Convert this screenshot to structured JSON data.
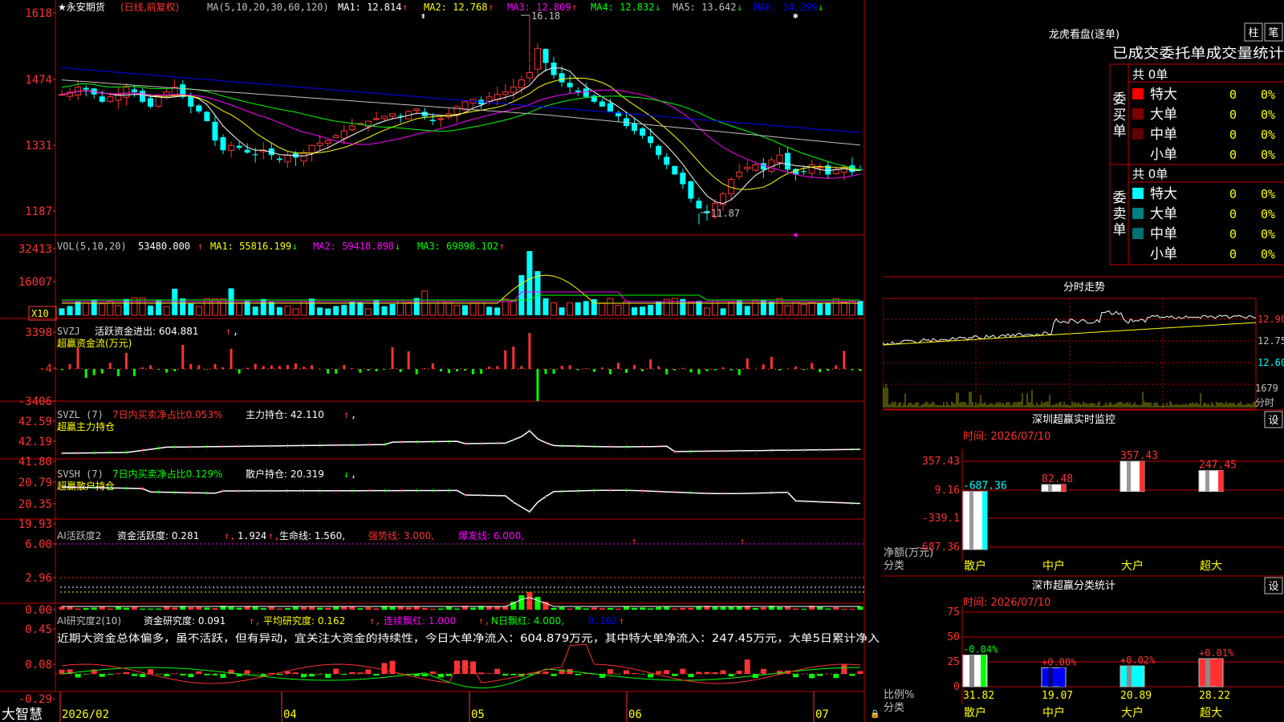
{
  "colors": {
    "up": "#ff3232",
    "down": "#00ffff",
    "frame": "#c00000",
    "green": "#00ff00",
    "yellow": "#ffff00",
    "magenta": "#ff00ff",
    "white": "#ffffff",
    "teal": "#008080",
    "darkred": "#800000",
    "gray": "#c0c0c0",
    "blue": "#0000ff"
  },
  "kline": {
    "name": "★永安期货",
    "period": "(日线,前复权)",
    "ma_def": "MA(5,10,20,30,60,120)",
    "ma_items": [
      {
        "text": "MA1: 12.814",
        "arrow": "↑",
        "color": "#ffffff"
      },
      {
        "text": "MA2: 12.768",
        "arrow": "↑",
        "color": "#ffff00"
      },
      {
        "text": "MA3: 12.809",
        "arrow": "↑",
        "color": "#ff00ff"
      },
      {
        "text": "MA4: 12.832",
        "arrow": "↓",
        "color": "#00ff00"
      },
      {
        "text": "MA5: 13.642",
        "arrow": "↓",
        "color": "#c0c0c0"
      },
      {
        "text": "MA6: 14.299",
        "arrow": "↓",
        "color": "#0000ff"
      }
    ],
    "yticks": [
      "1618",
      "1474",
      "1331",
      "1187"
    ],
    "high_label": "16.18",
    "low_label": "11.87",
    "ylim": [
      11.7,
      16.3
    ],
    "high": 16.18,
    "low": 11.87
  },
  "vol": {
    "label": "VOL(5,10,20)",
    "value": "53480.000",
    "items": [
      {
        "text": "MA1: 55816.199",
        "arrow": "↓",
        "color": "#ffff00"
      },
      {
        "text": "MA2: 59418.898",
        "arrow": "↓",
        "color": "#ff00ff"
      },
      {
        "text": "MA3: 69898.102",
        "arrow": "↑",
        "color": "#00ff00"
      }
    ],
    "yticks": [
      "32413",
      "16007"
    ],
    "unit": "X10"
  },
  "svzj": {
    "label": "SVZJ",
    "value_text": "活跃资金进出: 604.881",
    "arrow": "↑",
    "tail": ",",
    "sub": "超赢资金流(万元)",
    "yticks": [
      "3398",
      "-4",
      "-3406"
    ]
  },
  "svzl": {
    "label": "SVZL (7)",
    "ratio_text": "7日内买卖净占比0.053%",
    "value_text": "主力持仓: 42.110",
    "arrow": "↑",
    "tail": ",",
    "sub": "超赢主力持仓",
    "yticks": [
      "42.59",
      "42.19",
      "41.80"
    ]
  },
  "svsh": {
    "label": "SVSH (7)",
    "ratio_text": "7日内买卖净占比0.129%",
    "value_text": "散户持仓: 20.319",
    "arrow": "↓",
    "tail": ",",
    "sub": "超赢散户持仓",
    "yticks": [
      "20.79",
      "20.35",
      "19.93"
    ]
  },
  "ai1": {
    "label": "AI活跃度2",
    "t1": "资金活跃度: 0.281",
    "t2": "1.924",
    "t3": "生命线: 1.560,",
    "t4": "强势线: 3.000,",
    "t5": "爆发线: 6.000,",
    "yticks": [
      "6.00",
      "2.96",
      "0.00"
    ]
  },
  "ai2": {
    "label": "AI研究度2(10)",
    "t1": "资金研究度: 0.091",
    "t2": "平均研究度: 0.162",
    "t3": "连续飘红: 1.000",
    "t4": "N日飘红: 4.000,",
    "t5": "0.162",
    "text": "近期大资金总体偏多，虽不活跃，但有异动，宜关注大资金的持续性，今日大单净流入：604.879万元，其中特大单净流入：247.45万元，大单5日累计净入",
    "yticks": [
      "0.45",
      "0.08",
      "-0.29"
    ]
  },
  "xaxis": {
    "brand": "大智慧",
    "labels": [
      "2026/02",
      "04",
      "05",
      "06",
      "07"
    ]
  },
  "lhb": {
    "title": "龙虎看盘(逐单)",
    "btn1": "柱",
    "btn2": "笔",
    "header": "已成交委托单成交量统计",
    "buy_label": "委买单",
    "sell_label": "委卖单",
    "buy_total": "共 0单",
    "sell_total": "共 0单",
    "buy_rows": [
      {
        "name": "特大",
        "count": "0",
        "pct": "0%",
        "color": "#ff0000"
      },
      {
        "name": "大单",
        "count": "0",
        "pct": "0%",
        "color": "#800000"
      },
      {
        "name": "中单",
        "count": "0",
        "pct": "0%",
        "color": "#600000"
      },
      {
        "name": "小单",
        "count": "0",
        "pct": "0%",
        "color": "#000000"
      }
    ],
    "sell_rows": [
      {
        "name": "特大",
        "count": "0",
        "pct": "0%",
        "color": "#00ffff"
      },
      {
        "name": "大单",
        "count": "0",
        "pct": "0%",
        "color": "#008080"
      },
      {
        "name": "中单",
        "count": "0",
        "pct": "0%",
        "color": "#007070"
      },
      {
        "name": "小单",
        "count": "0",
        "pct": "0%",
        "color": "#000000"
      }
    ]
  },
  "fenshi": {
    "title": "分时走势",
    "yticks": [
      "12.90",
      "12.75",
      "12.60"
    ],
    "vol_tick": "1679",
    "vol_label": "分时"
  },
  "monitor": {
    "title": "深圳超赢实时监控",
    "btn": "设",
    "time": "时间: 2026/07/10",
    "yticks": [
      "357.43",
      "9.16",
      "-339.1",
      "-687.36"
    ],
    "ylabel1": "净额(万元)",
    "ylabel2": "分类",
    "categories": [
      "散户",
      "中户",
      "大户",
      "超大"
    ],
    "values": [
      -687.36,
      82.48,
      357.43,
      247.45
    ],
    "value_labels": [
      "-687.36",
      "82.48",
      "357.43",
      "247.45"
    ],
    "ylim": [
      -687.36,
      357.43
    ]
  },
  "classify": {
    "title": "深市超赢分类统计",
    "btn": "设",
    "time": "时间: 2026/07/10",
    "yticks": [
      "75",
      "50",
      "25",
      "0"
    ],
    "ylabel1": "比例%",
    "ylabel2": "分类",
    "categories": [
      "散户",
      "中户",
      "大户",
      "超大"
    ],
    "values": [
      31.82,
      19.07,
      20.89,
      28.22
    ],
    "top_labels": [
      "-0.04%",
      "+0.00%",
      "+0.02%",
      "+0.01%"
    ],
    "value_labels": [
      "31.82",
      "19.07",
      "20.89",
      "28.22"
    ],
    "ylim": [
      0,
      75
    ]
  }
}
